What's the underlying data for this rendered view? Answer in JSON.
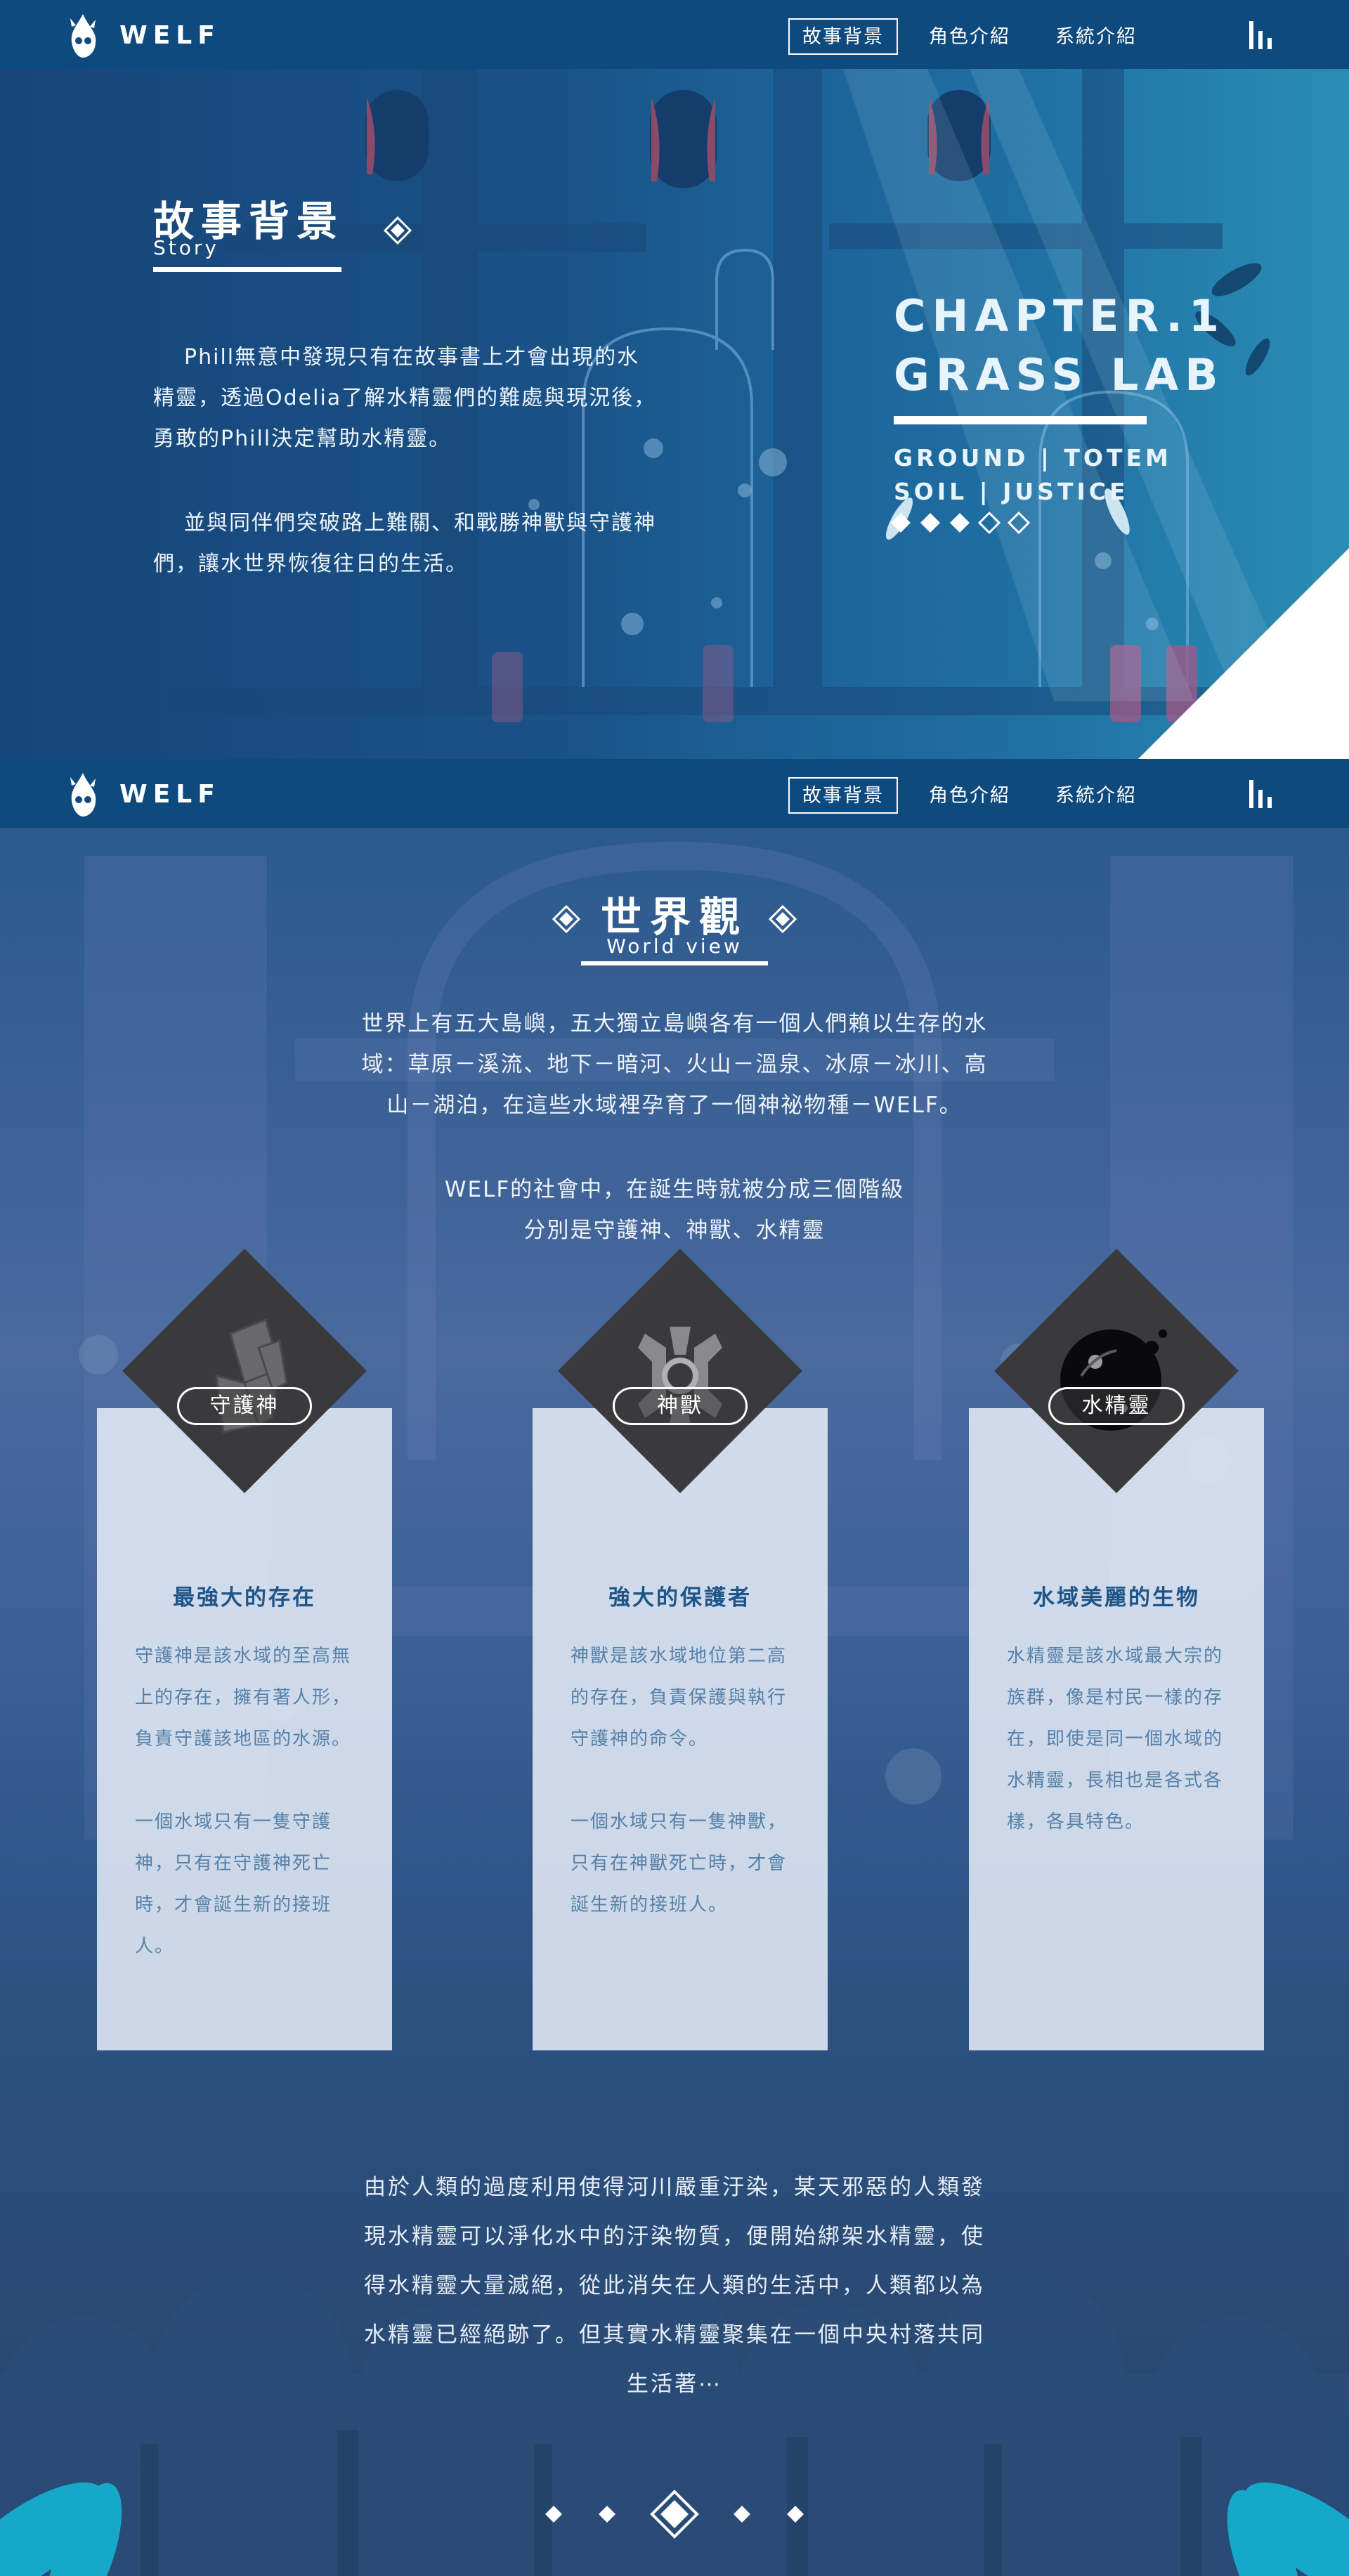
{
  "brand": {
    "name": "WELF",
    "logo_icon": "water-spirit-logo-icon"
  },
  "nav": {
    "items": [
      {
        "label": "故事背景",
        "active": true
      },
      {
        "label": "角色介紹",
        "active": false
      },
      {
        "label": "系統介紹",
        "active": false
      }
    ],
    "menu_icon": "bar-menu-icon"
  },
  "story": {
    "title": "故事背景",
    "subtitle": "Story",
    "paragraphs": [
      "Phill無意中發現只有在故事書上才會出現的水精靈，透過Odelia了解水精靈們的難處與現況後，勇敢的Phill決定幫助水精靈。",
      "並與同伴們突破路上難關、和戰勝神獸與守護神們，讓水世界恢復往日的生活。"
    ],
    "chapter": {
      "line1": "CHAPTER.1",
      "line2": "GRASS LAB",
      "tag1": "GROUND | TOTEM",
      "tag2": "SOIL | JUSTICE"
    }
  },
  "world": {
    "title": "世界觀",
    "subtitle": "World view",
    "intro_lines": [
      "世界上有五大島嶼，五大獨立島嶼各有一個人們賴以生存的水",
      "域：草原－溪流、地下－暗河、火山－溫泉、冰原－冰川、高",
      "山－湖泊，在這些水域裡孕育了一個神祕物種－WELF。"
    ],
    "class_lines": [
      "WELF的社會中，在誕生時就被分成三個階級",
      "分別是守護神、神獸、水精靈"
    ],
    "cards": [
      {
        "badge": "守護神",
        "icon": "guardian-crystal-icon",
        "heading": "最強大的存在",
        "lines": [
          "守護神是該水域的至高無",
          "上的存在，擁有著人形，",
          "負責守護該地區的水源。",
          "",
          "一個水域只有一隻守護",
          "神，只有在守護神死亡",
          "時，才會誕生新的接班",
          "人。"
        ]
      },
      {
        "badge": "神獸",
        "icon": "beast-emblem-icon",
        "heading": "強大的保護者",
        "lines": [
          "神獸是該水域地位第二高",
          "的存在，負責保護與執行",
          "守護神的命令。",
          "",
          "一個水域只有一隻神獸，",
          "只有在神獸死亡時，才會",
          "誕生新的接班人。"
        ]
      },
      {
        "badge": "水精靈",
        "icon": "water-spirit-orb-icon",
        "heading": "水域美麗的生物",
        "lines": [
          "水精靈是該水域最大宗的",
          "族群，像是村民一樣的存",
          "在，即使是同一個水域的",
          "水精靈，長相也是各式各",
          "樣，各具特色。"
        ]
      }
    ],
    "closing_lines": [
      "由於人類的過度利用使得河川嚴重汙染，某天邪惡的人類發",
      "現水精靈可以淨化水中的汙染物質，便開始綁架水精靈，使",
      "得水精靈大量滅絕，從此消失在人類的生活中，人類都以為",
      "水精靈已經絕跡了。但其實水精靈聚集在一個中央村落共同",
      "生活著⋯"
    ],
    "pager": {
      "count": 5,
      "active_index": 2
    }
  },
  "colors": {
    "nav": "#0e4a7e",
    "card_heading": "#1f5588",
    "card_text": "#5680a8",
    "diamond": "#3a3a3c"
  }
}
